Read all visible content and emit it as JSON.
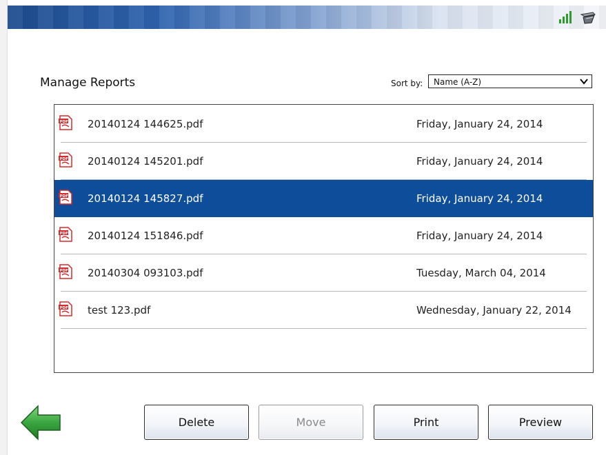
{
  "colors": {
    "accent": "#0e4d9a",
    "title_bar_dark": "#1d4c8f",
    "back_arrow": "#3aa640",
    "pdf_red": "#d62a2a"
  },
  "header": {
    "title": "Manage Reports",
    "icons": [
      "signal-strength-icon",
      "tray-pen-icon"
    ]
  },
  "sort": {
    "label": "Sort by:",
    "selected": "Name (A-Z)"
  },
  "files": [
    {
      "name": "20140124 144625.pdf",
      "date": "Friday, January 24, 2014",
      "selected": false
    },
    {
      "name": "20140124 145201.pdf",
      "date": "Friday, January 24, 2014",
      "selected": false
    },
    {
      "name": "20140124 145827.pdf",
      "date": "Friday, January 24, 2014",
      "selected": true
    },
    {
      "name": "20140124 151846.pdf",
      "date": "Friday, January 24, 2014",
      "selected": false
    },
    {
      "name": "20140304 093103.pdf",
      "date": "Tuesday, March 04, 2014",
      "selected": false
    },
    {
      "name": "test 123.pdf",
      "date": "Wednesday, January 22, 2014",
      "selected": false
    }
  ],
  "buttons": {
    "delete": "Delete",
    "move": "Move",
    "print": "Print",
    "preview": "Preview"
  }
}
